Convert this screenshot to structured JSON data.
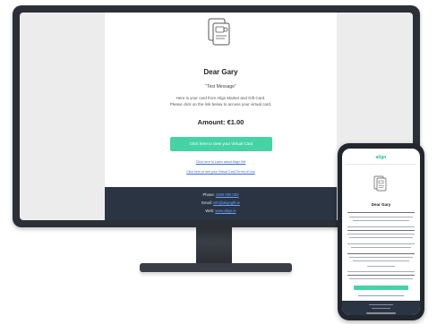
{
  "monitor_email": {
    "greeting": "Dear Gary",
    "message": "Test Message",
    "body_line1": "Here is your card from Align Market and Gift Card.",
    "body_line2": "Please click on the link below to access your virtual card.",
    "amount": "Amount: €1.00",
    "cta_label": "Click here to view your Virtual Card",
    "link_1": "Click here to Learn about Align Gift",
    "link_2": "Click here to see your Virtual Card Terms of Use",
    "footer": {
      "phone_label": "Phone:",
      "phone_value": "1800 000 000",
      "email_label": "Email:",
      "email_value": "info@aligngift.ie",
      "web_label": "Web:",
      "web_value": "www.align.ie"
    }
  },
  "phone_email": {
    "brand": "align",
    "greeting": "Dear Gary"
  },
  "colors": {
    "accent_green": "#45d3a5",
    "footer_navy": "#2b3442",
    "link_blue": "#3c6ad8"
  },
  "icons": {
    "monitor_email_icon": "virtual-card-document-icon",
    "phone_email_icon": "virtual-card-document-icon"
  }
}
